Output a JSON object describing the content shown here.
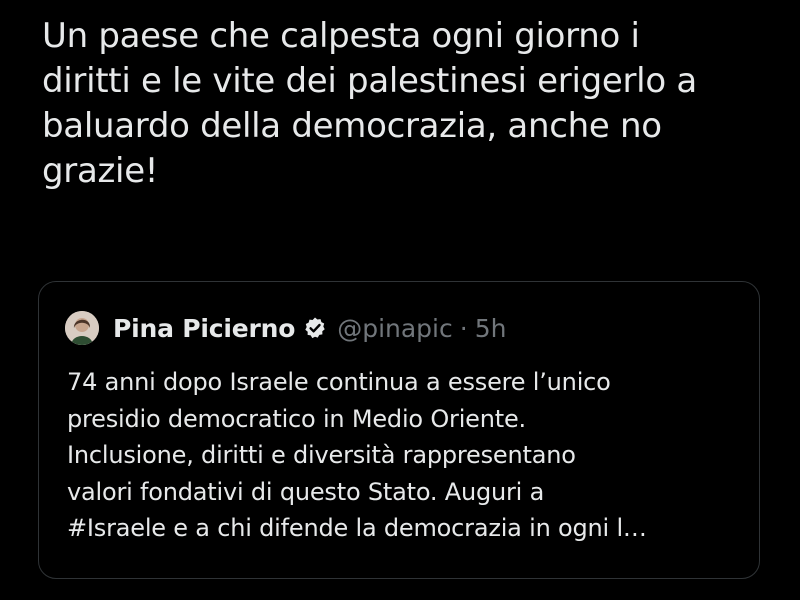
{
  "tweet": {
    "text": "Un paese che calpesta ogni giorno i\ndiritti e le vite dei palestinesi erigerlo a\nbaluardo della democrazia, anche no\ngrazie!"
  },
  "quoted_tweet": {
    "author_name": "Pina Picierno",
    "handle": "@pinapic",
    "separator": "·",
    "time": "5h",
    "verified": true,
    "text": "74 anni dopo Israele continua a essere l’unico\npresidio democratico in Medio Oriente.\nInclusione, diritti e diversità rappresentano\nvalori fondativi di questo Stato. Auguri a\n#Israele e a chi difende la democrazia in ogni l…"
  },
  "colors": {
    "background": "#000000",
    "primary_text": "#e7e9ea",
    "secondary_text": "#71767b",
    "card_border": "#2f3336",
    "verified_badge": "#e7e9ea"
  }
}
